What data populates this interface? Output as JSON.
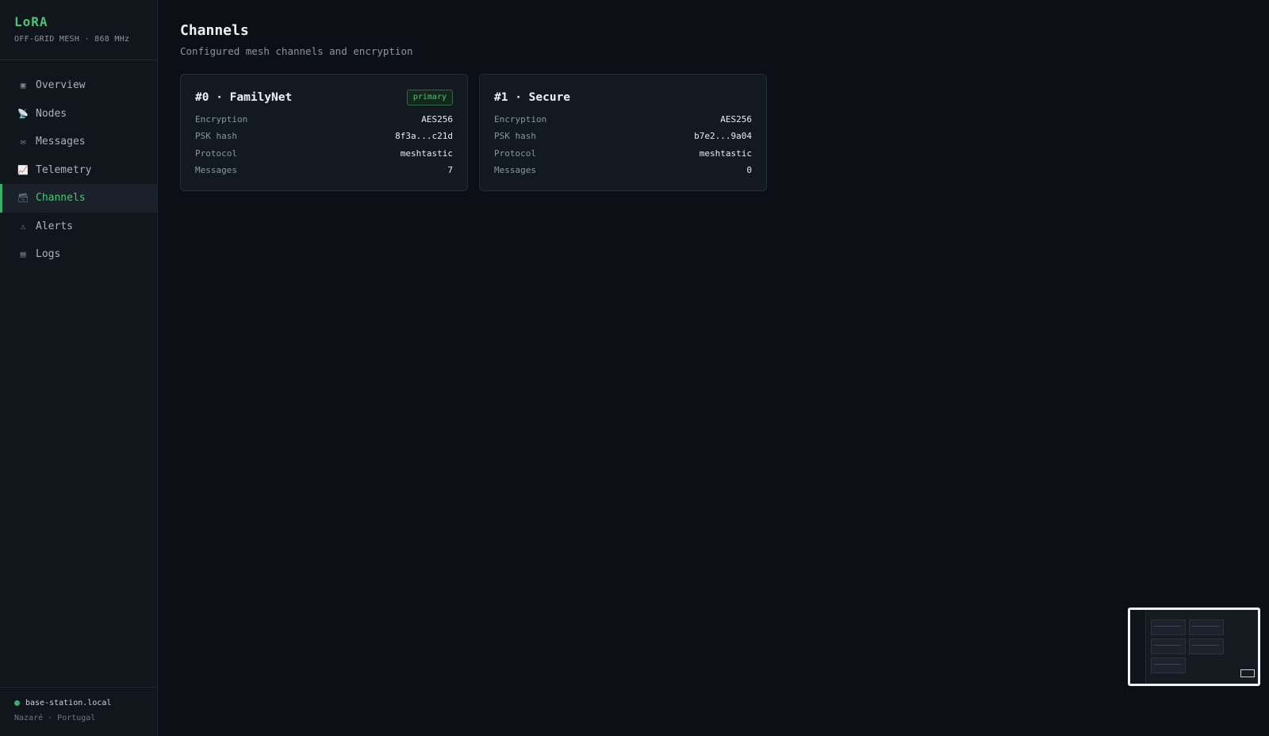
{
  "brand": {
    "title": "LoRA",
    "subtitle": "OFF-GRID MESH · 868 MHz"
  },
  "nav": {
    "items": [
      {
        "label": "Overview",
        "icon": "overview-icon",
        "glyph": "▣",
        "active": false
      },
      {
        "label": "Nodes",
        "icon": "satellite-dish-icon",
        "glyph": "📡",
        "active": false
      },
      {
        "label": "Messages",
        "icon": "envelope-icon",
        "glyph": "✉",
        "active": false
      },
      {
        "label": "Telemetry",
        "icon": "chart-icon",
        "glyph": "📈",
        "active": false
      },
      {
        "label": "Channels",
        "icon": "card-box-icon",
        "glyph": "🗃",
        "active": true
      },
      {
        "label": "Alerts",
        "icon": "warning-icon",
        "glyph": "⚠",
        "active": false
      },
      {
        "label": "Logs",
        "icon": "logs-icon",
        "glyph": "▤",
        "active": false
      }
    ]
  },
  "footer": {
    "host": "base-station.local",
    "location": "Nazaré · Portugal"
  },
  "page": {
    "title": "Channels",
    "subtitle": "Configured mesh channels and encryption"
  },
  "channels": [
    {
      "title": "#0 · FamilyNet",
      "badge": "primary",
      "rows": [
        {
          "key": "Encryption",
          "value": "AES256"
        },
        {
          "key": "PSK hash",
          "value": "8f3a...c21d"
        },
        {
          "key": "Protocol",
          "value": "meshtastic"
        },
        {
          "key": "Messages",
          "value": "7"
        }
      ]
    },
    {
      "title": "#1 · Secure",
      "badge": "",
      "rows": [
        {
          "key": "Encryption",
          "value": "AES256"
        },
        {
          "key": "PSK hash",
          "value": "b7e2...9a04"
        },
        {
          "key": "Protocol",
          "value": "meshtastic"
        },
        {
          "key": "Messages",
          "value": "0"
        }
      ]
    }
  ],
  "colors": {
    "accent": "#4ec27a",
    "background": "#0c1016",
    "sidebar": "#11161d",
    "card": "#131921"
  }
}
